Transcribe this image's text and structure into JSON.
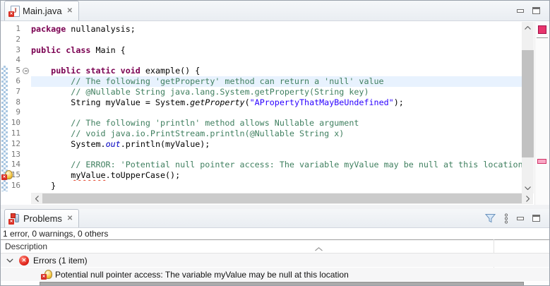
{
  "editor": {
    "tab_title": "Main.java",
    "lines": [
      {
        "num": "1",
        "segments": [
          [
            "keyword",
            "package"
          ],
          [
            "plain",
            " nullanalysis;"
          ]
        ]
      },
      {
        "num": "2",
        "segments": []
      },
      {
        "num": "3",
        "segments": [
          [
            "keyword",
            "public class"
          ],
          [
            "plain",
            " Main {"
          ]
        ]
      },
      {
        "num": "4",
        "segments": []
      },
      {
        "num": "5",
        "fold": true,
        "segments": [
          [
            "plain",
            "    "
          ],
          [
            "keyword",
            "public static void"
          ],
          [
            "plain",
            " example() {"
          ]
        ]
      },
      {
        "num": "6",
        "current": true,
        "segments": [
          [
            "comment",
            "        // The following 'getProperty' method can return a 'null' value"
          ]
        ]
      },
      {
        "num": "7",
        "segments": [
          [
            "comment",
            "        // @Nullable String java.lang.System.getProperty(String key)"
          ]
        ]
      },
      {
        "num": "8",
        "segments": [
          [
            "plain",
            "        String myValue = System."
          ],
          [
            "static_method",
            "getProperty"
          ],
          [
            "plain",
            "("
          ],
          [
            "string",
            "\"APropertyThatMayBeUndefined\""
          ],
          [
            "plain",
            ");"
          ]
        ]
      },
      {
        "num": "9",
        "segments": []
      },
      {
        "num": "10",
        "segments": [
          [
            "comment",
            "        // The following 'println' method allows Nullable argument"
          ]
        ]
      },
      {
        "num": "11",
        "segments": [
          [
            "comment",
            "        // void java.io.PrintStream.println(@Nullable String x)"
          ]
        ]
      },
      {
        "num": "12",
        "segments": [
          [
            "plain",
            "        System."
          ],
          [
            "static_field",
            "out"
          ],
          [
            "plain",
            ".println(myValue);"
          ]
        ]
      },
      {
        "num": "13",
        "segments": []
      },
      {
        "num": "14",
        "segments": [
          [
            "comment",
            "        // ERROR: 'Potential null pointer access: The variable myValue may be null at this location'"
          ]
        ]
      },
      {
        "num": "15",
        "icon": "error-bulb",
        "segments": [
          [
            "plain",
            "        "
          ],
          [
            "error",
            "myValue"
          ],
          [
            "plain",
            ".toUpperCase();"
          ]
        ]
      },
      {
        "num": "16",
        "segments": [
          [
            "plain",
            "    }"
          ]
        ]
      }
    ]
  },
  "problems": {
    "tab_title": "Problems",
    "summary": "1 error, 0 warnings, 0 others",
    "column_header": "Description",
    "group_label": "Errors (1 item)",
    "error_message": "Potential null pointer access: The variable myValue may be null at this location"
  },
  "icons": {
    "close_glyph": "✕",
    "editor_tab_icon": "java-file-error-icon",
    "problems_tab_icon": "problems-view-icon",
    "filter_icon": "funnel-icon",
    "view_menu_icon": "vertical-dots-icon"
  },
  "colors": {
    "keyword": "#7B0052",
    "comment": "#3F7F5F",
    "string": "#2A00FF",
    "static_field": "#0000C0",
    "current_line_highlight": "#E8F2FE",
    "error_overview_marker": "#E8356D",
    "line_number": "#787878"
  }
}
